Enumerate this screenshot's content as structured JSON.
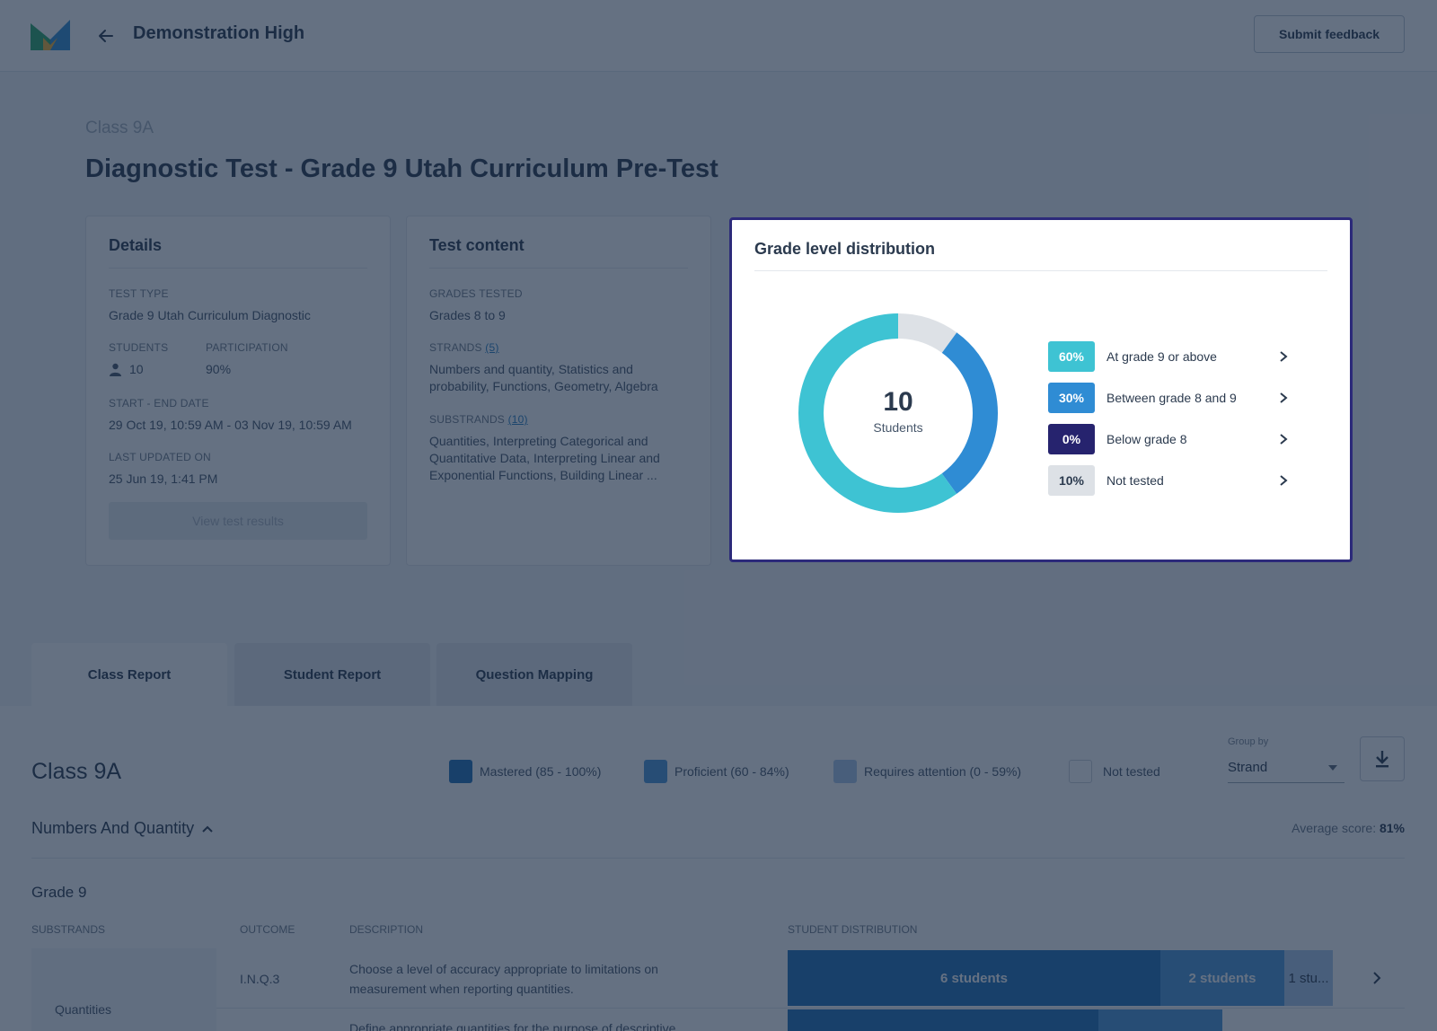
{
  "header": {
    "school_name": "Demonstration High",
    "submit_feedback_label": "Submit feedback",
    "logo_icon": "app-logo-icon",
    "back_icon": "arrow-left-icon"
  },
  "hero": {
    "class_name": "Class 9A",
    "page_title": "Diagnostic Test - Grade 9 Utah Curriculum Pre-Test"
  },
  "details": {
    "title": "Details",
    "test_type_label": "TEST TYPE",
    "test_type_value": "Grade 9 Utah Curriculum Diagnostic",
    "students_label": "STUDENTS",
    "students_value": "10",
    "participation_label": "PARTICIPATION",
    "participation_value": "90%",
    "dates_label": "START - END DATE",
    "dates_value": "29 Oct 19, 10:59 AM - 03 Nov 19, 10:59 AM",
    "updated_label": "LAST UPDATED ON",
    "updated_value": "25 Jun 19, 1:41 PM",
    "view_results_label": "View test results"
  },
  "test_content": {
    "title": "Test content",
    "grades_label": "GRADES TESTED",
    "grades_value": "Grades 8 to 9",
    "strands_label": "STRANDS",
    "strands_count": "(5)",
    "strands_line1": "Numbers and quantity, Statistics and",
    "strands_line2": "probability, Functions, Geometry, Algebra",
    "substrands_label": "SUBSTRANDS",
    "substrands_count": "(10)",
    "substrands_line1": "Quantities, Interpreting Categorical and",
    "substrands_line2": "Quantitative Data, Interpreting Linear and",
    "substrands_line3": "Exponential Functions, Building Linear ..."
  },
  "grade_distribution": {
    "title": "Grade level distribution",
    "center_value": "10",
    "center_label": "Students",
    "items": [
      {
        "pct": "60%",
        "label": "At grade 9 or above",
        "value": 60,
        "color": "#3ec3d3",
        "text_color": "#ffffff"
      },
      {
        "pct": "30%",
        "label": "Between grade 8 and 9",
        "value": 30,
        "color": "#2f8cd4",
        "text_color": "#ffffff"
      },
      {
        "pct": "0%",
        "label": "Below grade 8",
        "value": 0,
        "color": "#26236e",
        "text_color": "#ffffff"
      },
      {
        "pct": "10%",
        "label": "Not tested",
        "value": 10,
        "color": "#dde1e6",
        "text_color": "#2b3a4e"
      }
    ]
  },
  "tabs": [
    {
      "label": "Class Report",
      "active": true
    },
    {
      "label": "Student Report",
      "active": false
    },
    {
      "label": "Question Mapping",
      "active": false
    }
  ],
  "report": {
    "class_name": "Class 9A",
    "key": [
      {
        "label": "Mastered (85 - 100%)",
        "color": "#1f6fb8"
      },
      {
        "label": "Proficient (60 - 84%)",
        "color": "#4b96d8"
      },
      {
        "label": "Requires attention (0 - 59%)",
        "color": "#a9c8ea"
      },
      {
        "label": "Not tested",
        "color": "#ffffff"
      }
    ],
    "group_by_label": "Group by",
    "group_by_value": "Strand",
    "strand_title": "Numbers And Quantity",
    "average_label": "Average score:",
    "average_value": "81%",
    "grade_title": "Grade 9",
    "columns": {
      "substrands": "SUBSTRANDS",
      "outcome": "OUTCOME",
      "description": "DESCRIPTION",
      "distribution": "STUDENT DISTRIBUTION"
    },
    "rows": [
      {
        "substrand": "Quantities",
        "outcome": "I.N.Q.3",
        "description": "Choose a level of accuracy appropriate to limitations on measurement when reporting quantities.",
        "segments": [
          {
            "label": "6 students",
            "count": 6
          },
          {
            "label": "2 students",
            "count": 2
          },
          {
            "label": "1 stu...",
            "count": 1
          }
        ]
      },
      {
        "description": "Define appropriate quantities for the purpose of descriptive"
      }
    ]
  }
}
